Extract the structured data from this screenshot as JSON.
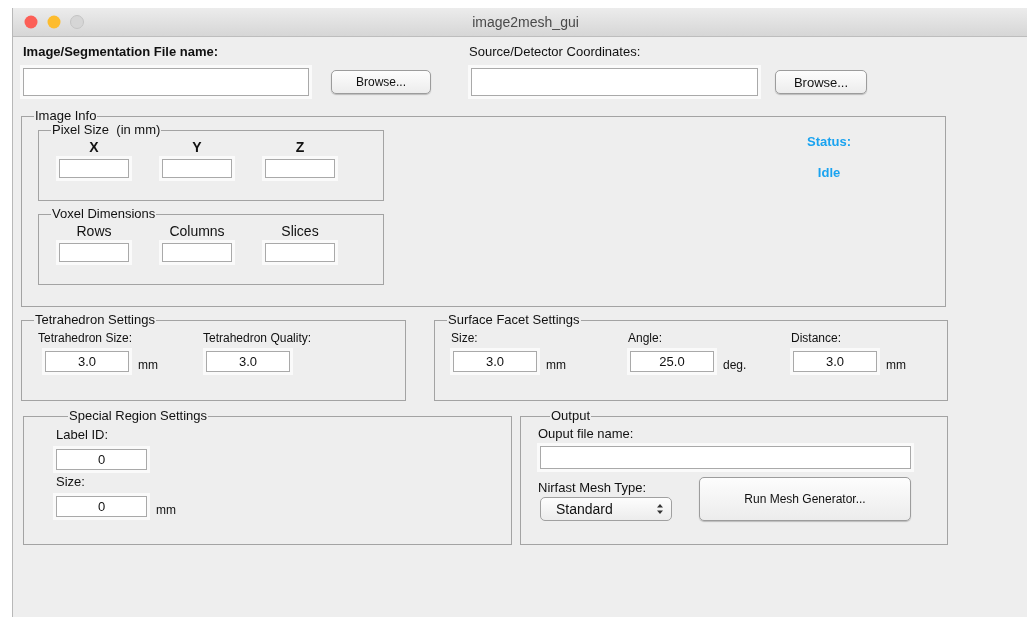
{
  "window": {
    "title": "image2mesh_gui"
  },
  "image_file": {
    "label": "Image/Segmentation File name:",
    "button": "Browse..."
  },
  "source_file": {
    "label": "Source/Detector Coordinates:",
    "button": "Browse..."
  },
  "image_info": {
    "title": "Image Info",
    "pixel_size": {
      "title": "Pixel Size  (in mm)",
      "columns": [
        "X",
        "Y",
        "Z"
      ]
    },
    "voxel_dimensions": {
      "title": "Voxel Dimensions",
      "columns": [
        "Rows",
        "Columns",
        "Slices"
      ]
    },
    "status_label": "Status:",
    "status_value": "Idle"
  },
  "tetrahedron": {
    "title": "Tetrahedron Settings",
    "fields": [
      {
        "label": "Tetrahedron Size:",
        "value": "3.0",
        "unit": "mm"
      },
      {
        "label": "Tetrahedron Quality:",
        "value": "3.0"
      }
    ]
  },
  "surface_facet": {
    "title": "Surface Facet Settings",
    "fields": [
      {
        "label": "Size:",
        "value": "3.0",
        "unit": "mm"
      },
      {
        "label": "Angle:",
        "value": "25.0",
        "unit": "deg."
      },
      {
        "label": "Distance:",
        "value": "3.0",
        "unit": "mm"
      }
    ]
  },
  "special_region": {
    "title": "Special Region Settings",
    "fields": [
      {
        "label": "Label ID:",
        "value": "0"
      },
      {
        "label": "Size:",
        "value": "0",
        "unit": "mm"
      }
    ]
  },
  "output": {
    "title": "Output",
    "file_label": "Ouput file name:",
    "mesh_type_label": "Nirfast Mesh Type:",
    "mesh_type": "Standard",
    "run_button": "Run Mesh Generator..."
  }
}
